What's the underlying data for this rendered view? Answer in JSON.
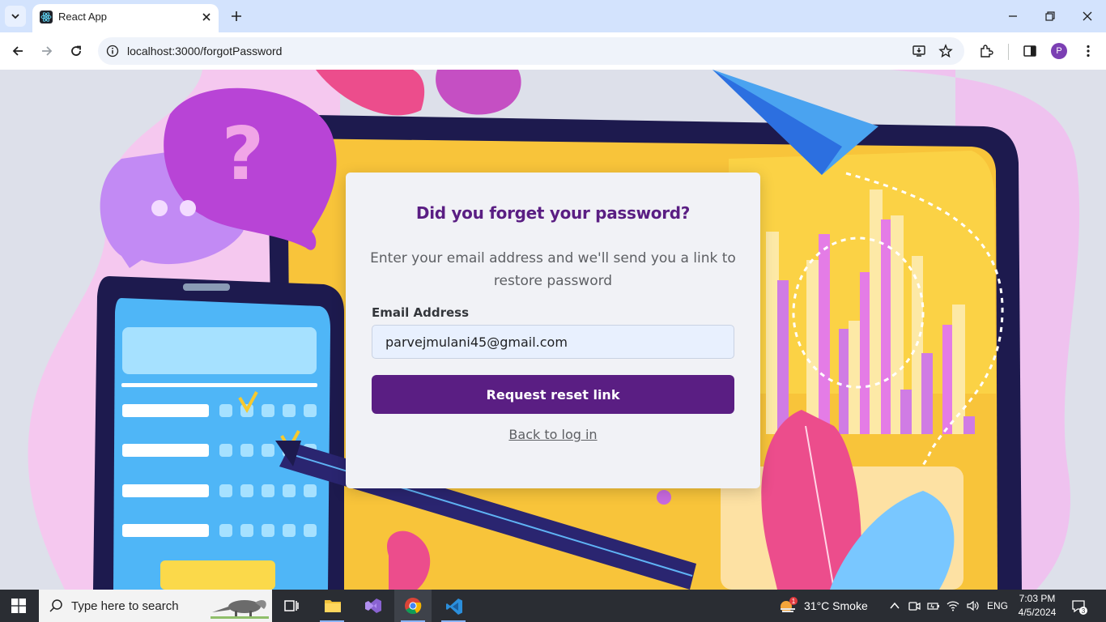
{
  "browser": {
    "tab_title": "React App",
    "url": "localhost:3000/forgotPassword",
    "profile_initial": "P"
  },
  "page": {
    "title": "Did you forget your password?",
    "subtitle": "Enter your email address and we'll send you a link to restore password",
    "email_label": "Email Address",
    "email_value": "parvejmulani45@gmail.com",
    "submit_label": "Request reset link",
    "back_link": "Back to log in"
  },
  "taskbar": {
    "search_placeholder": "Type here to search",
    "weather": "31°C  Smoke",
    "weather_badge": "1",
    "language": "ENG",
    "time": "7:03 PM",
    "date": "4/5/2024",
    "notification_count": "3"
  },
  "colors": {
    "accent": "#5a1e83",
    "tabstrip": "#d3e3fd",
    "taskbar": "#2a2d33"
  }
}
